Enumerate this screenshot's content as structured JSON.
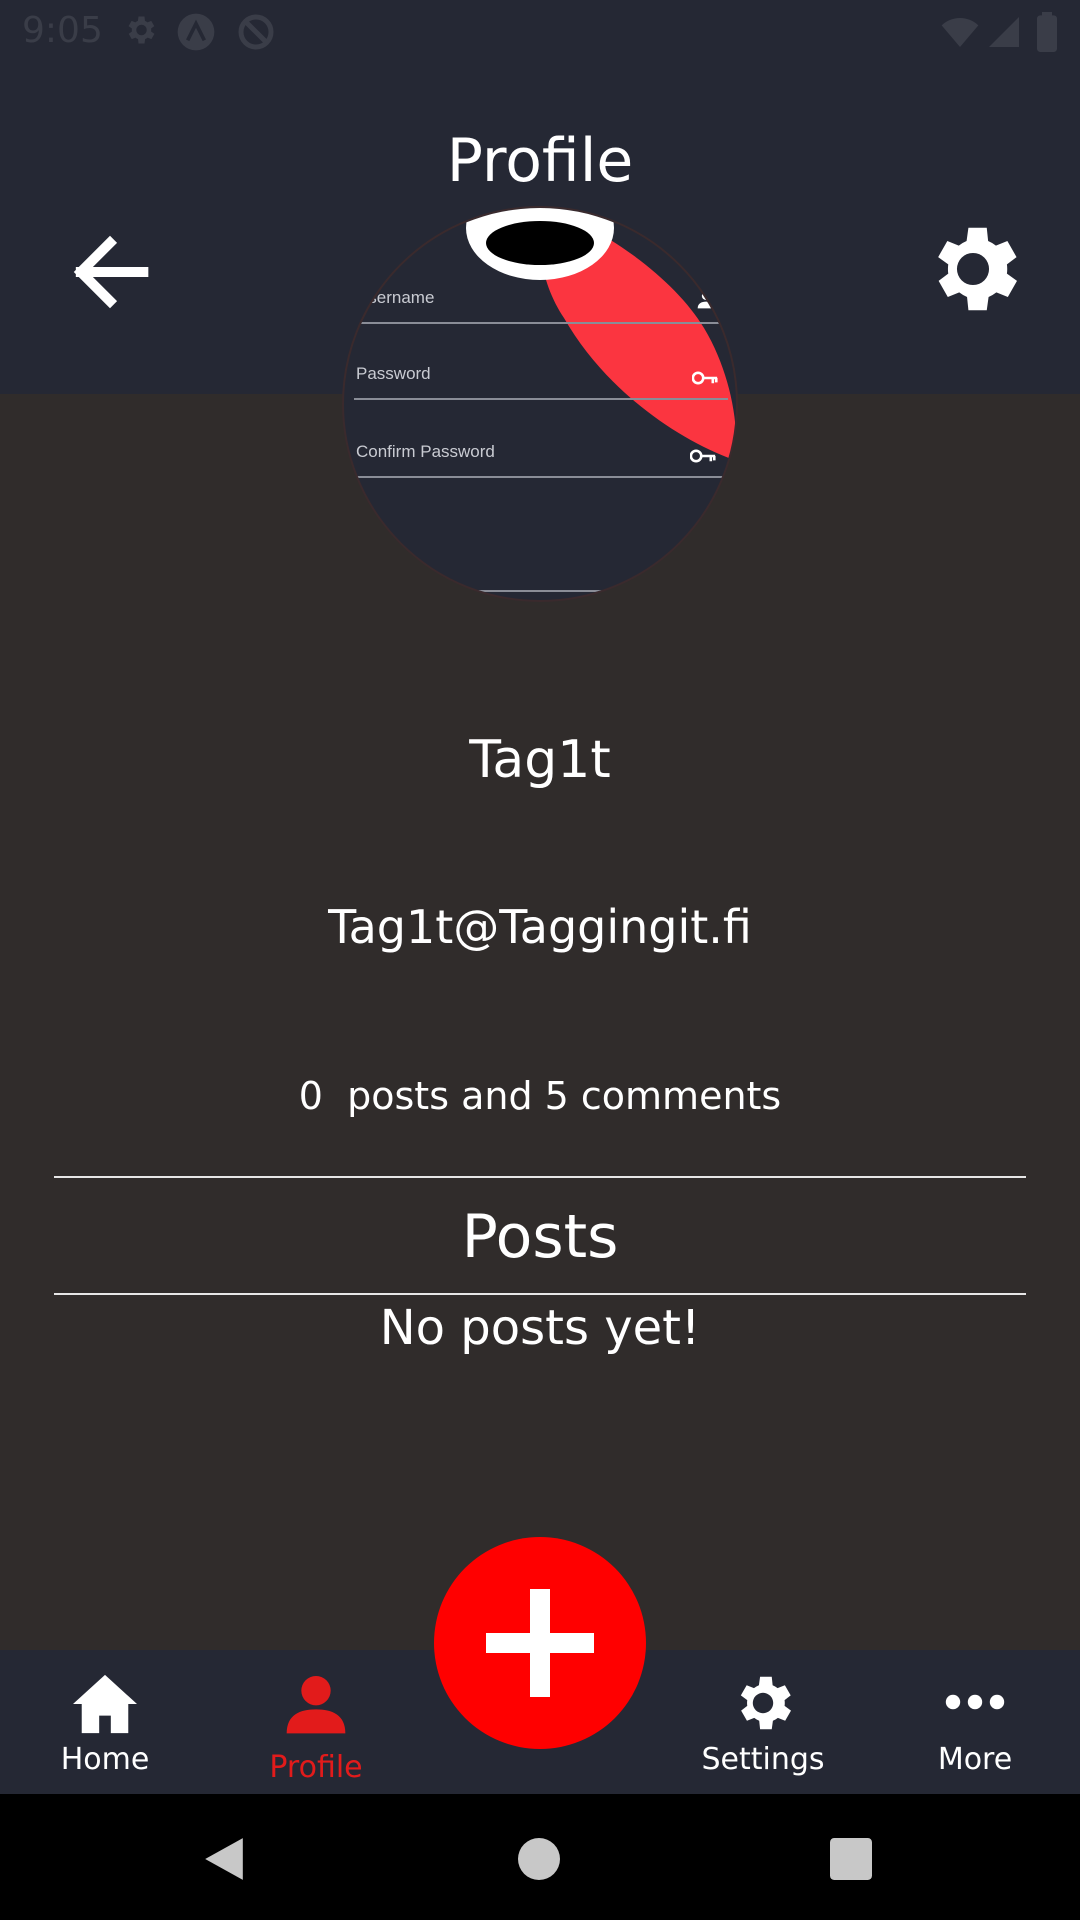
{
  "status_bar": {
    "time": "9:05",
    "icons": [
      "settings-icon",
      "app-a-icon",
      "sync-blocked-icon",
      "wifi-icon",
      "signal-icon",
      "battery-icon"
    ]
  },
  "header": {
    "title": "Profile",
    "back_icon": "arrow-left-icon",
    "settings_icon": "gear-icon"
  },
  "avatar": {
    "fields": [
      {
        "label": "Username",
        "icon": "person-icon"
      },
      {
        "label": "Password",
        "icon": "key-icon"
      },
      {
        "label": "Confirm Password",
        "icon": "key-icon"
      }
    ]
  },
  "profile": {
    "username": "Tag1t",
    "email": "Tag1t@Taggingit.fi",
    "posts_count": "0",
    "stats_text": "posts and 5 comments"
  },
  "posts": {
    "heading": "Posts",
    "empty_text": "No posts yet!"
  },
  "fab": {
    "icon": "plus-icon"
  },
  "bottom_nav": [
    {
      "label": "Home",
      "icon": "home-icon",
      "active": false
    },
    {
      "label": "Profile",
      "icon": "person-icon",
      "active": true
    },
    {
      "label": "Settings",
      "icon": "gear-icon",
      "active": false
    },
    {
      "label": "More",
      "icon": "more-horizontal-icon",
      "active": false
    }
  ],
  "system_nav": [
    "back-triangle-icon",
    "home-circle-icon",
    "recents-square-icon"
  ],
  "colors": {
    "header_bg": "#252834",
    "body_bg": "#302c2b",
    "accent": "#ff0000",
    "active_tab": "#e21b1b"
  }
}
